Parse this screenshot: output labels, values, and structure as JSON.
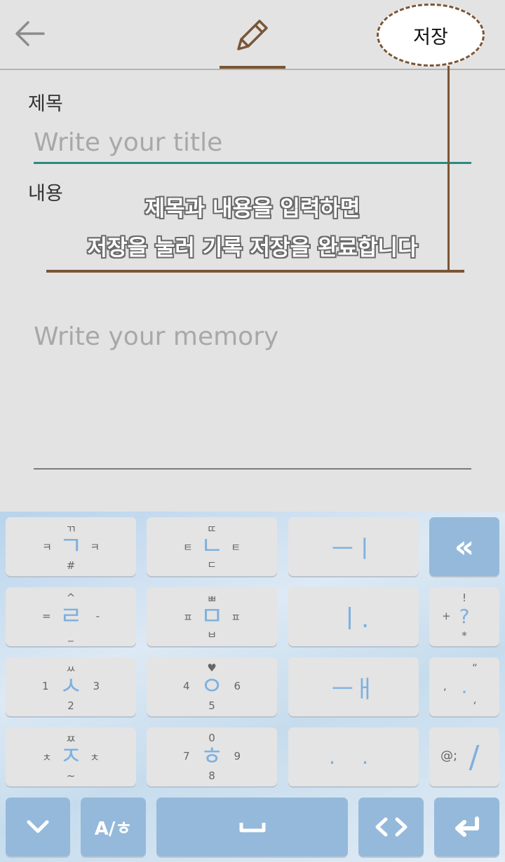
{
  "header": {
    "back_icon": "arrow-left-icon",
    "edit_icon": "pencil-icon",
    "save_label": "저장"
  },
  "form": {
    "title_label": "제목",
    "title_placeholder": "Write your title",
    "content_label": "내용",
    "content_placeholder": "Write your memory"
  },
  "annotation": {
    "line1": "제목과 내용을 입력하면",
    "line2": "저장을 눌러 기록 저장을 완료합니다"
  },
  "keyboard": {
    "rows": [
      [
        {
          "top": "ㄲ",
          "left": "ㅋ",
          "main": "ㄱ",
          "right": "ㅋ",
          "bottom": "#"
        },
        {
          "top": "ㄸ",
          "left": "ㅌ",
          "main": "ㄴ",
          "right": "ㅌ",
          "bottom": "ㄷ"
        },
        {
          "main": "ㅡㅣ"
        },
        {
          "main": "«"
        }
      ],
      [
        {
          "top": "^",
          "left": "=",
          "main": "ㄹ",
          "right": "-",
          "bottom": "_"
        },
        {
          "top": "ㅃ",
          "left": "ㅍ",
          "main": "ㅁ",
          "right": "ㅍ",
          "bottom": "ㅂ"
        },
        {
          "main": "ㅣ."
        },
        {
          "top": "!",
          "left": "+",
          "main": "?",
          "bottom": "*"
        }
      ],
      [
        {
          "top": "ㅆ",
          "left": "1",
          "main": "ㅅ",
          "right": "3",
          "bottom": "2"
        },
        {
          "top": "♥",
          "left": "4",
          "main": "ㅇ",
          "right": "6",
          "bottom": "5"
        },
        {
          "main": "ㅡㅐ"
        },
        {
          "top": "“",
          "left": ",",
          "main": ".",
          "bottom": "‘"
        }
      ],
      [
        {
          "top": "ㅉ",
          "left": "ㅊ",
          "main": "ㅈ",
          "right": "ㅊ",
          "bottom": "~"
        },
        {
          "top": "0",
          "left": "7",
          "main": "ㅎ",
          "right": "9",
          "bottom": "8"
        },
        {
          "main": ". ."
        },
        {
          "left": "@;",
          "main": "/"
        }
      ]
    ],
    "bottom_row": {
      "collapse_icon": "chevron-down-icon",
      "lang_label": "A/ㅎ",
      "space_icon": "space-icon",
      "cursor_icon": "angle-brackets-icon",
      "enter_icon": "enter-icon"
    }
  }
}
